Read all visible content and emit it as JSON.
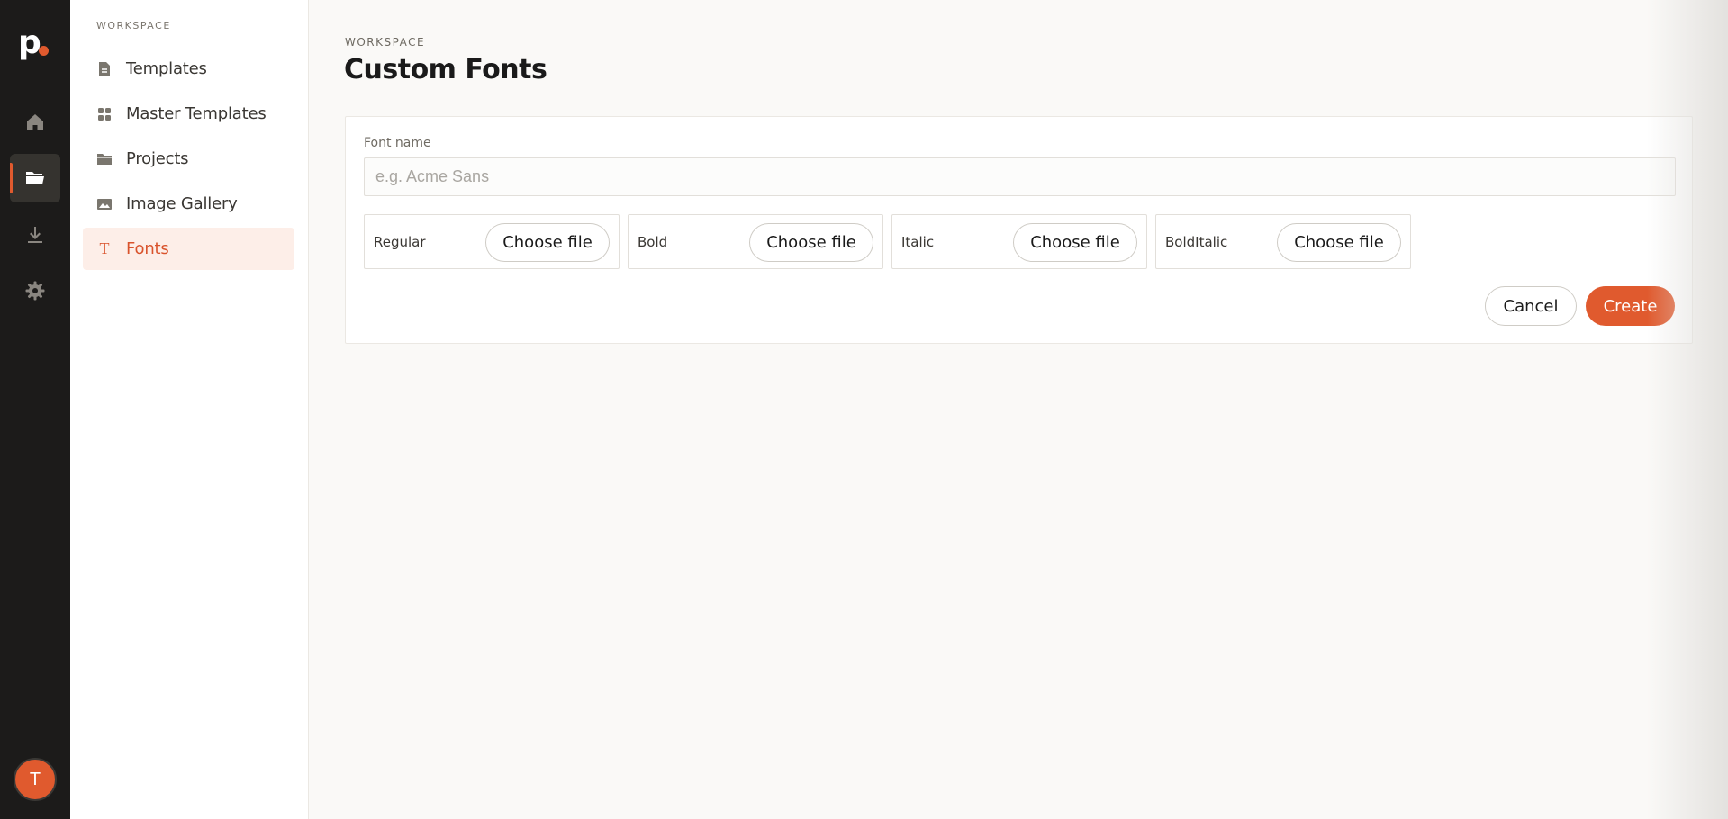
{
  "rail": {
    "logo_letter": "p",
    "brand_color": "#e05a2e",
    "items": [
      {
        "name": "home",
        "icon": "home-icon",
        "active": false
      },
      {
        "name": "folders",
        "icon": "folder-icon",
        "active": true
      },
      {
        "name": "downloads",
        "icon": "download-icon",
        "active": false
      },
      {
        "name": "settings",
        "icon": "gear-icon",
        "active": false
      }
    ],
    "avatar_initial": "T"
  },
  "sidebar": {
    "heading": "WORKSPACE",
    "items": [
      {
        "label": "Templates",
        "icon": "document-icon"
      },
      {
        "label": "Master Templates",
        "icon": "grid-icon"
      },
      {
        "label": "Projects",
        "icon": "folder-icon"
      },
      {
        "label": "Image Gallery",
        "icon": "image-icon"
      },
      {
        "label": "Fonts",
        "icon": "type-icon",
        "active": true
      }
    ]
  },
  "header": {
    "eyebrow": "WORKSPACE",
    "title": "Custom Fonts"
  },
  "form": {
    "font_name_label": "Font name",
    "font_name_value": "",
    "font_name_placeholder": "e.g. Acme Sans",
    "slots": [
      {
        "label": "Regular",
        "button": "Choose file"
      },
      {
        "label": "Bold",
        "button": "Choose file"
      },
      {
        "label": "Italic",
        "button": "Choose file"
      },
      {
        "label": "BoldItalic",
        "button": "Choose file"
      }
    ],
    "cancel_label": "Cancel",
    "create_label": "Create"
  }
}
